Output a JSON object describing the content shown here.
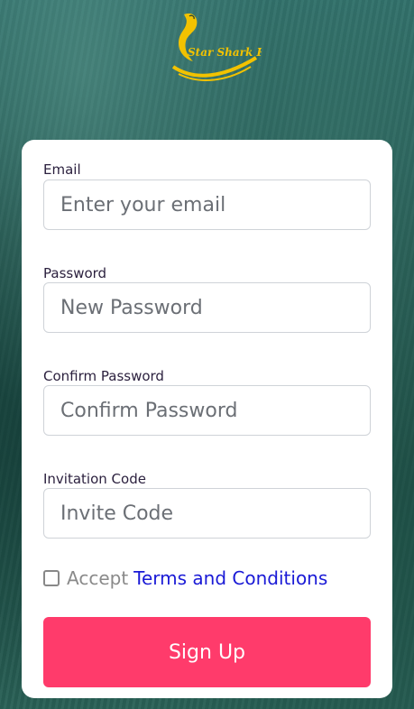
{
  "brand": {
    "logo_text": "Star Shark Pro$"
  },
  "form": {
    "email_label": "Email",
    "email_placeholder": "Enter your email",
    "password_label": "Password",
    "password_placeholder": "New Password",
    "confirm_label": "Confirm Password",
    "confirm_placeholder": "Confirm Password",
    "invite_label": "Invitation Code",
    "invite_placeholder": "Invite Code",
    "accept_text": "Accept",
    "terms_link": "Terms and Conditions",
    "terms_checked": false,
    "submit_label": "Sign Up"
  },
  "colors": {
    "submit_button": "#ff3b6b",
    "terms_link": "#1a1ad6",
    "logo_gold": "#f2c200"
  }
}
